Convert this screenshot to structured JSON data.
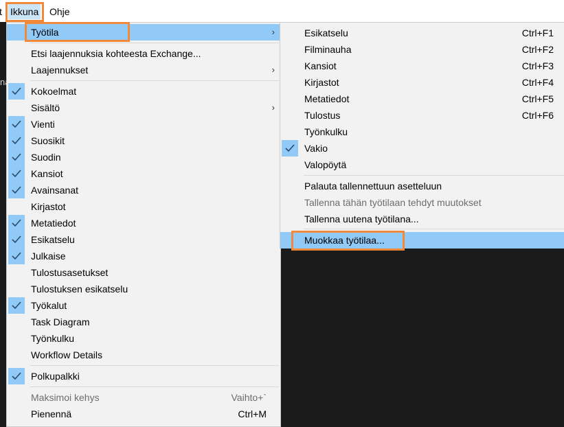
{
  "menubar": {
    "items": [
      {
        "label": "t"
      },
      {
        "label": "Ikkuna"
      },
      {
        "label": "Ohje"
      }
    ]
  },
  "background": {
    "partial_text": "na"
  },
  "window_menu": {
    "items": [
      {
        "label": "Työtila",
        "checked": false,
        "submenu": true,
        "active": true
      },
      {
        "label": "Etsi laajennuksia kohteesta Exchange...",
        "checked": false
      },
      {
        "label": "Laajennukset",
        "checked": false,
        "submenu": true
      },
      {
        "label": "Kokoelmat",
        "checked": true
      },
      {
        "label": "Sisältö",
        "checked": false,
        "submenu": true
      },
      {
        "label": "Vienti",
        "checked": true
      },
      {
        "label": "Suosikit",
        "checked": true
      },
      {
        "label": "Suodin",
        "checked": true
      },
      {
        "label": "Kansiot",
        "checked": true
      },
      {
        "label": "Avainsanat",
        "checked": true
      },
      {
        "label": "Kirjastot",
        "checked": false
      },
      {
        "label": "Metatiedot",
        "checked": true
      },
      {
        "label": "Esikatselu",
        "checked": true
      },
      {
        "label": "Julkaise",
        "checked": true
      },
      {
        "label": "Tulostusasetukset",
        "checked": false
      },
      {
        "label": "Tulostuksen esikatselu",
        "checked": false
      },
      {
        "label": "Työkalut",
        "checked": true
      },
      {
        "label": "Task Diagram",
        "checked": false
      },
      {
        "label": "Työnkulku",
        "checked": false
      },
      {
        "label": "Workflow Details",
        "checked": false
      },
      {
        "label": "Polkupalkki",
        "checked": true
      },
      {
        "label": "Maksimoi kehys",
        "shortcut": "Vaihto+`",
        "disabled": true
      },
      {
        "label": "Pienennä",
        "shortcut": "Ctrl+M"
      }
    ]
  },
  "workspace_submenu": {
    "items": [
      {
        "label": "Esikatselu",
        "shortcut": "Ctrl+F1"
      },
      {
        "label": "Filminauha",
        "shortcut": "Ctrl+F2"
      },
      {
        "label": "Kansiot",
        "shortcut": "Ctrl+F3"
      },
      {
        "label": "Kirjastot",
        "shortcut": "Ctrl+F4"
      },
      {
        "label": "Metatiedot",
        "shortcut": "Ctrl+F5"
      },
      {
        "label": "Tulostus",
        "shortcut": "Ctrl+F6"
      },
      {
        "label": "Työnkulku"
      },
      {
        "label": "Vakio",
        "checked": true
      },
      {
        "label": "Valopöytä"
      },
      {
        "label": "Palauta tallennettuun asetteluun"
      },
      {
        "label": "Tallenna tähän työtilaan tehdyt muutokset",
        "disabled": true
      },
      {
        "label": "Tallenna uutena työtilana..."
      },
      {
        "label": "Muokkaa työtilaa...",
        "active": true
      }
    ]
  },
  "colors": {
    "highlight": "#91c9f7",
    "annotation_outline": "#f08a3a",
    "menu_bg": "#f2f2f2"
  }
}
